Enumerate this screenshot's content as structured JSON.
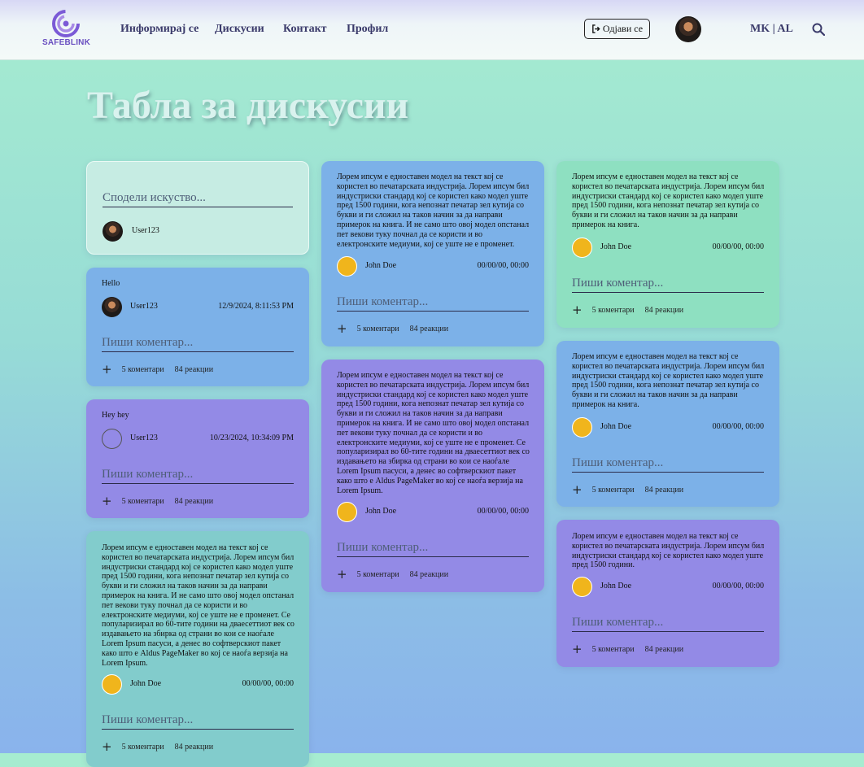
{
  "brand": {
    "name": "SAFEBLINK",
    "logo_icon": "spiral-logo-icon",
    "logo_color": "#7b5ad6"
  },
  "nav": {
    "links": [
      "Информирај се",
      "Дискусии",
      "Контакт",
      "Профил"
    ],
    "logout_label": "Одјави се",
    "logout_icon": "sign-out-icon",
    "language": "MK | AL",
    "search_icon": "search-icon"
  },
  "page": {
    "title": "Табла за дискусии"
  },
  "share": {
    "placeholder": "Сподели искуство...",
    "user": "User123"
  },
  "placeholders": {
    "comment": "Пиши коментар..."
  },
  "labels": {
    "comments": "5 коментари",
    "reactions": "84 реакции",
    "add": "+"
  },
  "texts": {
    "long": "Лорем ипсум е едноставен модел на текст кој се користел во печатарската индустрија. Лорем ипсум бил индустриски стандард кој се користел како модел уште пред 1500 години, кога непознат печатар зел кутија со букви и ги сложил на таков начин за да направи примерок на книга. И не само што овој модел опстанал пет векови туку почнал да се користи и во електронските медиуми, кој се уште не е променет. Се популаризирал во 60-тите години на дваесеттиот век со издавањето на збирка од страни во кои се наоѓале Lorem Ipsum пасуси, а денес во софтверскиот пакет како што е Aldus PageMaker во кој се наоѓа верзија на Lorem Ipsum.",
    "medium": "Лорем ипсум е едноставен модел на текст кој се користел во печатарската индустрија. Лорем ипсум бил индустриски стандард кој се користел како модел уште пред 1500 години, кога непознат печатар зел кутија со букви и ги сложил на таков начин за да направи примерок на книга. И не само што овој модел опстанал пет векови туку почнал да се користи и во електронските медиуми, кој се уште не е променет.",
    "short": "Лорем ипсум е едноставен модел на текст кој се користел во печатарската индустрија. Лорем ипсум бил индустриски стандард кој се користел како модел уште пред 1500 години, кога непознат печатар зел кутија со букви и ги сложил на таков начин за да направи примерок на книга.",
    "tiny": "Лорем ипсум е едноставен модел на текст кој се користел во печатарската индустрија. Лорем ипсум бил индустриски стандард кој се користел како модел уште пред 1500 години."
  },
  "posts": {
    "hello": {
      "title": "Hello",
      "author": "User123",
      "date": "12/9/2024, 8:11:53 PM"
    },
    "hey": {
      "title": "Hey hey",
      "author": "User123",
      "date": "10/23/2024, 10:34:09 PM"
    },
    "john": {
      "author": "John Doe",
      "date": "00/00/00, 00:00"
    }
  },
  "colors": {
    "blue": "#7cb1e8",
    "purple": "#938ae6",
    "teal": "#82cccc",
    "green": "#8ee0c1"
  }
}
